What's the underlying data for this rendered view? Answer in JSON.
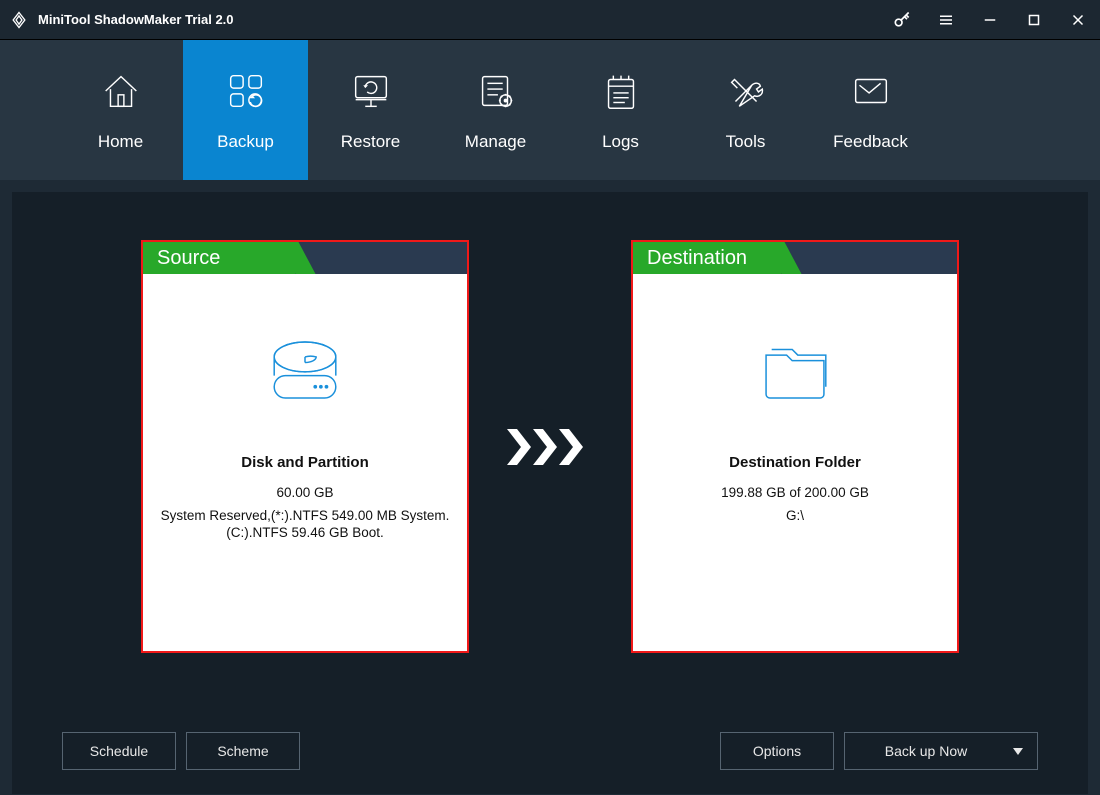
{
  "title": "MiniTool ShadowMaker Trial 2.0",
  "nav": {
    "home": "Home",
    "backup": "Backup",
    "restore": "Restore",
    "manage": "Manage",
    "logs": "Logs",
    "tools": "Tools",
    "feedback": "Feedback"
  },
  "source": {
    "tab": "Source",
    "title": "Disk and Partition",
    "size": "60.00 GB",
    "line1": "System Reserved,(*:).NTFS 549.00 MB System.",
    "line2": "(C:).NTFS 59.46 GB Boot."
  },
  "destination": {
    "tab": "Destination",
    "title": "Destination Folder",
    "size": "199.88 GB of 200.00 GB",
    "path": "G:\\"
  },
  "buttons": {
    "schedule": "Schedule",
    "scheme": "Scheme",
    "options": "Options",
    "backupnow": "Back up Now"
  }
}
